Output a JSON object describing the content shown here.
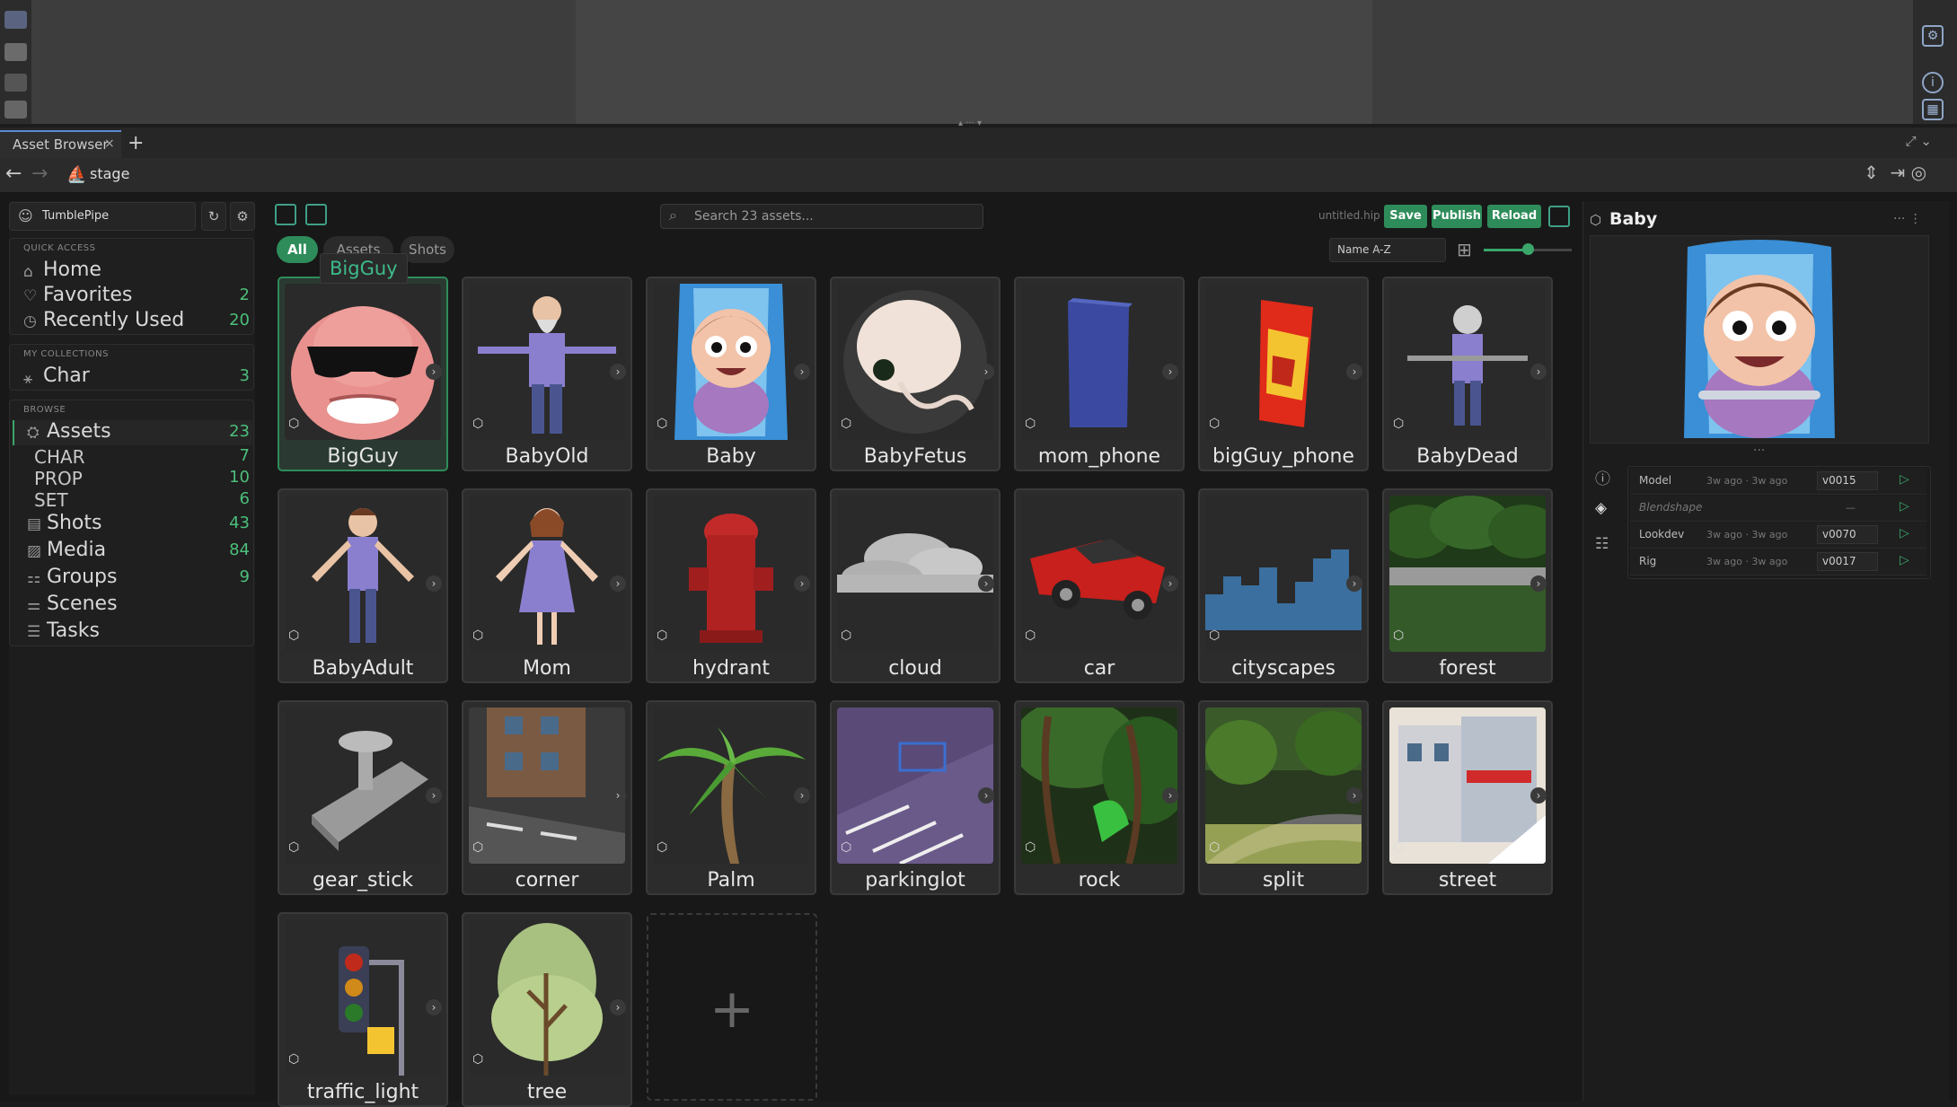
{
  "window": {
    "tab_label": "Asset Browser",
    "tab_close": "×",
    "tab_add": "+"
  },
  "pathbar": {
    "back": "←",
    "forward": "→",
    "path": "stage"
  },
  "sidebar": {
    "project": "TumblePipe",
    "quick_access_title": "QUICK ACCESS",
    "quick_access": [
      {
        "label": "Home",
        "count": ""
      },
      {
        "label": "Favorites",
        "count": "2"
      },
      {
        "label": "Recently Used",
        "count": "20"
      }
    ],
    "collections_title": "MY COLLECTIONS",
    "collections": [
      {
        "label": "Char",
        "count": "3"
      }
    ],
    "browse_title": "BROWSE",
    "browse": [
      {
        "label": "Assets",
        "count": "23"
      },
      {
        "label": "CHAR",
        "count": "7"
      },
      {
        "label": "PROP",
        "count": "10"
      },
      {
        "label": "SET",
        "count": "6"
      },
      {
        "label": "Shots",
        "count": "43"
      },
      {
        "label": "Media",
        "count": "84"
      },
      {
        "label": "Groups",
        "count": "9"
      },
      {
        "label": "Scenes",
        "count": ""
      },
      {
        "label": "Tasks",
        "count": ""
      }
    ]
  },
  "toolbar": {
    "filters": [
      "All",
      "Assets",
      "Shots"
    ],
    "tooltip": "BigGuy",
    "search_placeholder": "Search 23 assets...",
    "file_name": "untitled.hip",
    "save": "Save",
    "publish": "Publish",
    "reload": "Reload",
    "sort": "Name A-Z",
    "zoom_level": 0.5
  },
  "assets": [
    "BigGuy",
    "BabyOld",
    "Baby",
    "BabyFetus",
    "mom_phone",
    "bigGuy_phone",
    "BabyDead",
    "BabyAdult",
    "Mom",
    "hydrant",
    "cloud",
    "car",
    "cityscapes",
    "forest",
    "gear_stick",
    "corner",
    "Palm",
    "parkinglot",
    "rock",
    "split",
    "street",
    "traffic_light",
    "tree"
  ],
  "add_label": "+",
  "detail": {
    "title": "Baby",
    "rows": [
      {
        "name": "Model",
        "time": "3w ago · 3w ago",
        "version": "v0015"
      },
      {
        "name": "Blendshape",
        "time": "",
        "version": "—"
      },
      {
        "name": "Lookdev",
        "time": "3w ago · 3w ago",
        "version": "v0070"
      },
      {
        "name": "Rig",
        "time": "3w ago · 3w ago",
        "version": "v0017"
      }
    ]
  },
  "colors": {
    "accent": "#2e8c5a",
    "count": "#4cbf7a",
    "selected_border": "#2e8c5a"
  }
}
